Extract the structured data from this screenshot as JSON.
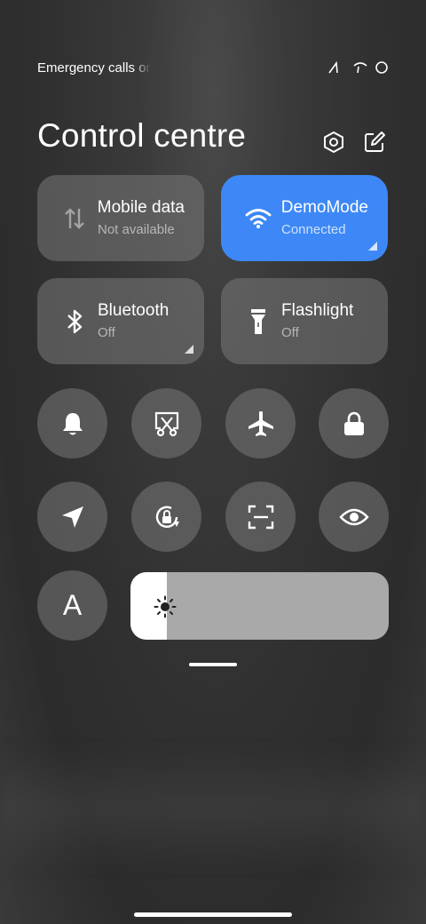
{
  "status_bar": {
    "text": "Emergency calls only",
    "icons": [
      "signal-icon",
      "wifi-icon",
      "battery-icon"
    ]
  },
  "header": {
    "title": "Control centre",
    "actions": [
      "settings-icon",
      "edit-icon"
    ]
  },
  "tiles": [
    {
      "id": "mobile-data",
      "label": "Mobile data",
      "status": "Not available",
      "icon": "mobile-data-icon",
      "active": false
    },
    {
      "id": "wifi",
      "label": "DemoMode",
      "status": "Connected",
      "icon": "wifi-icon",
      "active": true
    },
    {
      "id": "bluetooth",
      "label": "Bluetooth",
      "status": "Off",
      "icon": "bluetooth-icon",
      "active": false
    },
    {
      "id": "flashlight",
      "label": "Flashlight",
      "status": "Off",
      "icon": "flashlight-icon",
      "active": false
    }
  ],
  "toggles": [
    "bell-icon",
    "screenshot-icon",
    "airplane-icon",
    "lock-icon",
    "location-icon",
    "rotation-lock-icon",
    "scan-icon",
    "eye-icon"
  ],
  "font_toggle": {
    "glyph": "A"
  },
  "brightness": {
    "level": 0.14
  },
  "colors": {
    "accent": "#3d88f6",
    "tile": "#7a7a7a",
    "slider_track": "#a9a9a9"
  }
}
